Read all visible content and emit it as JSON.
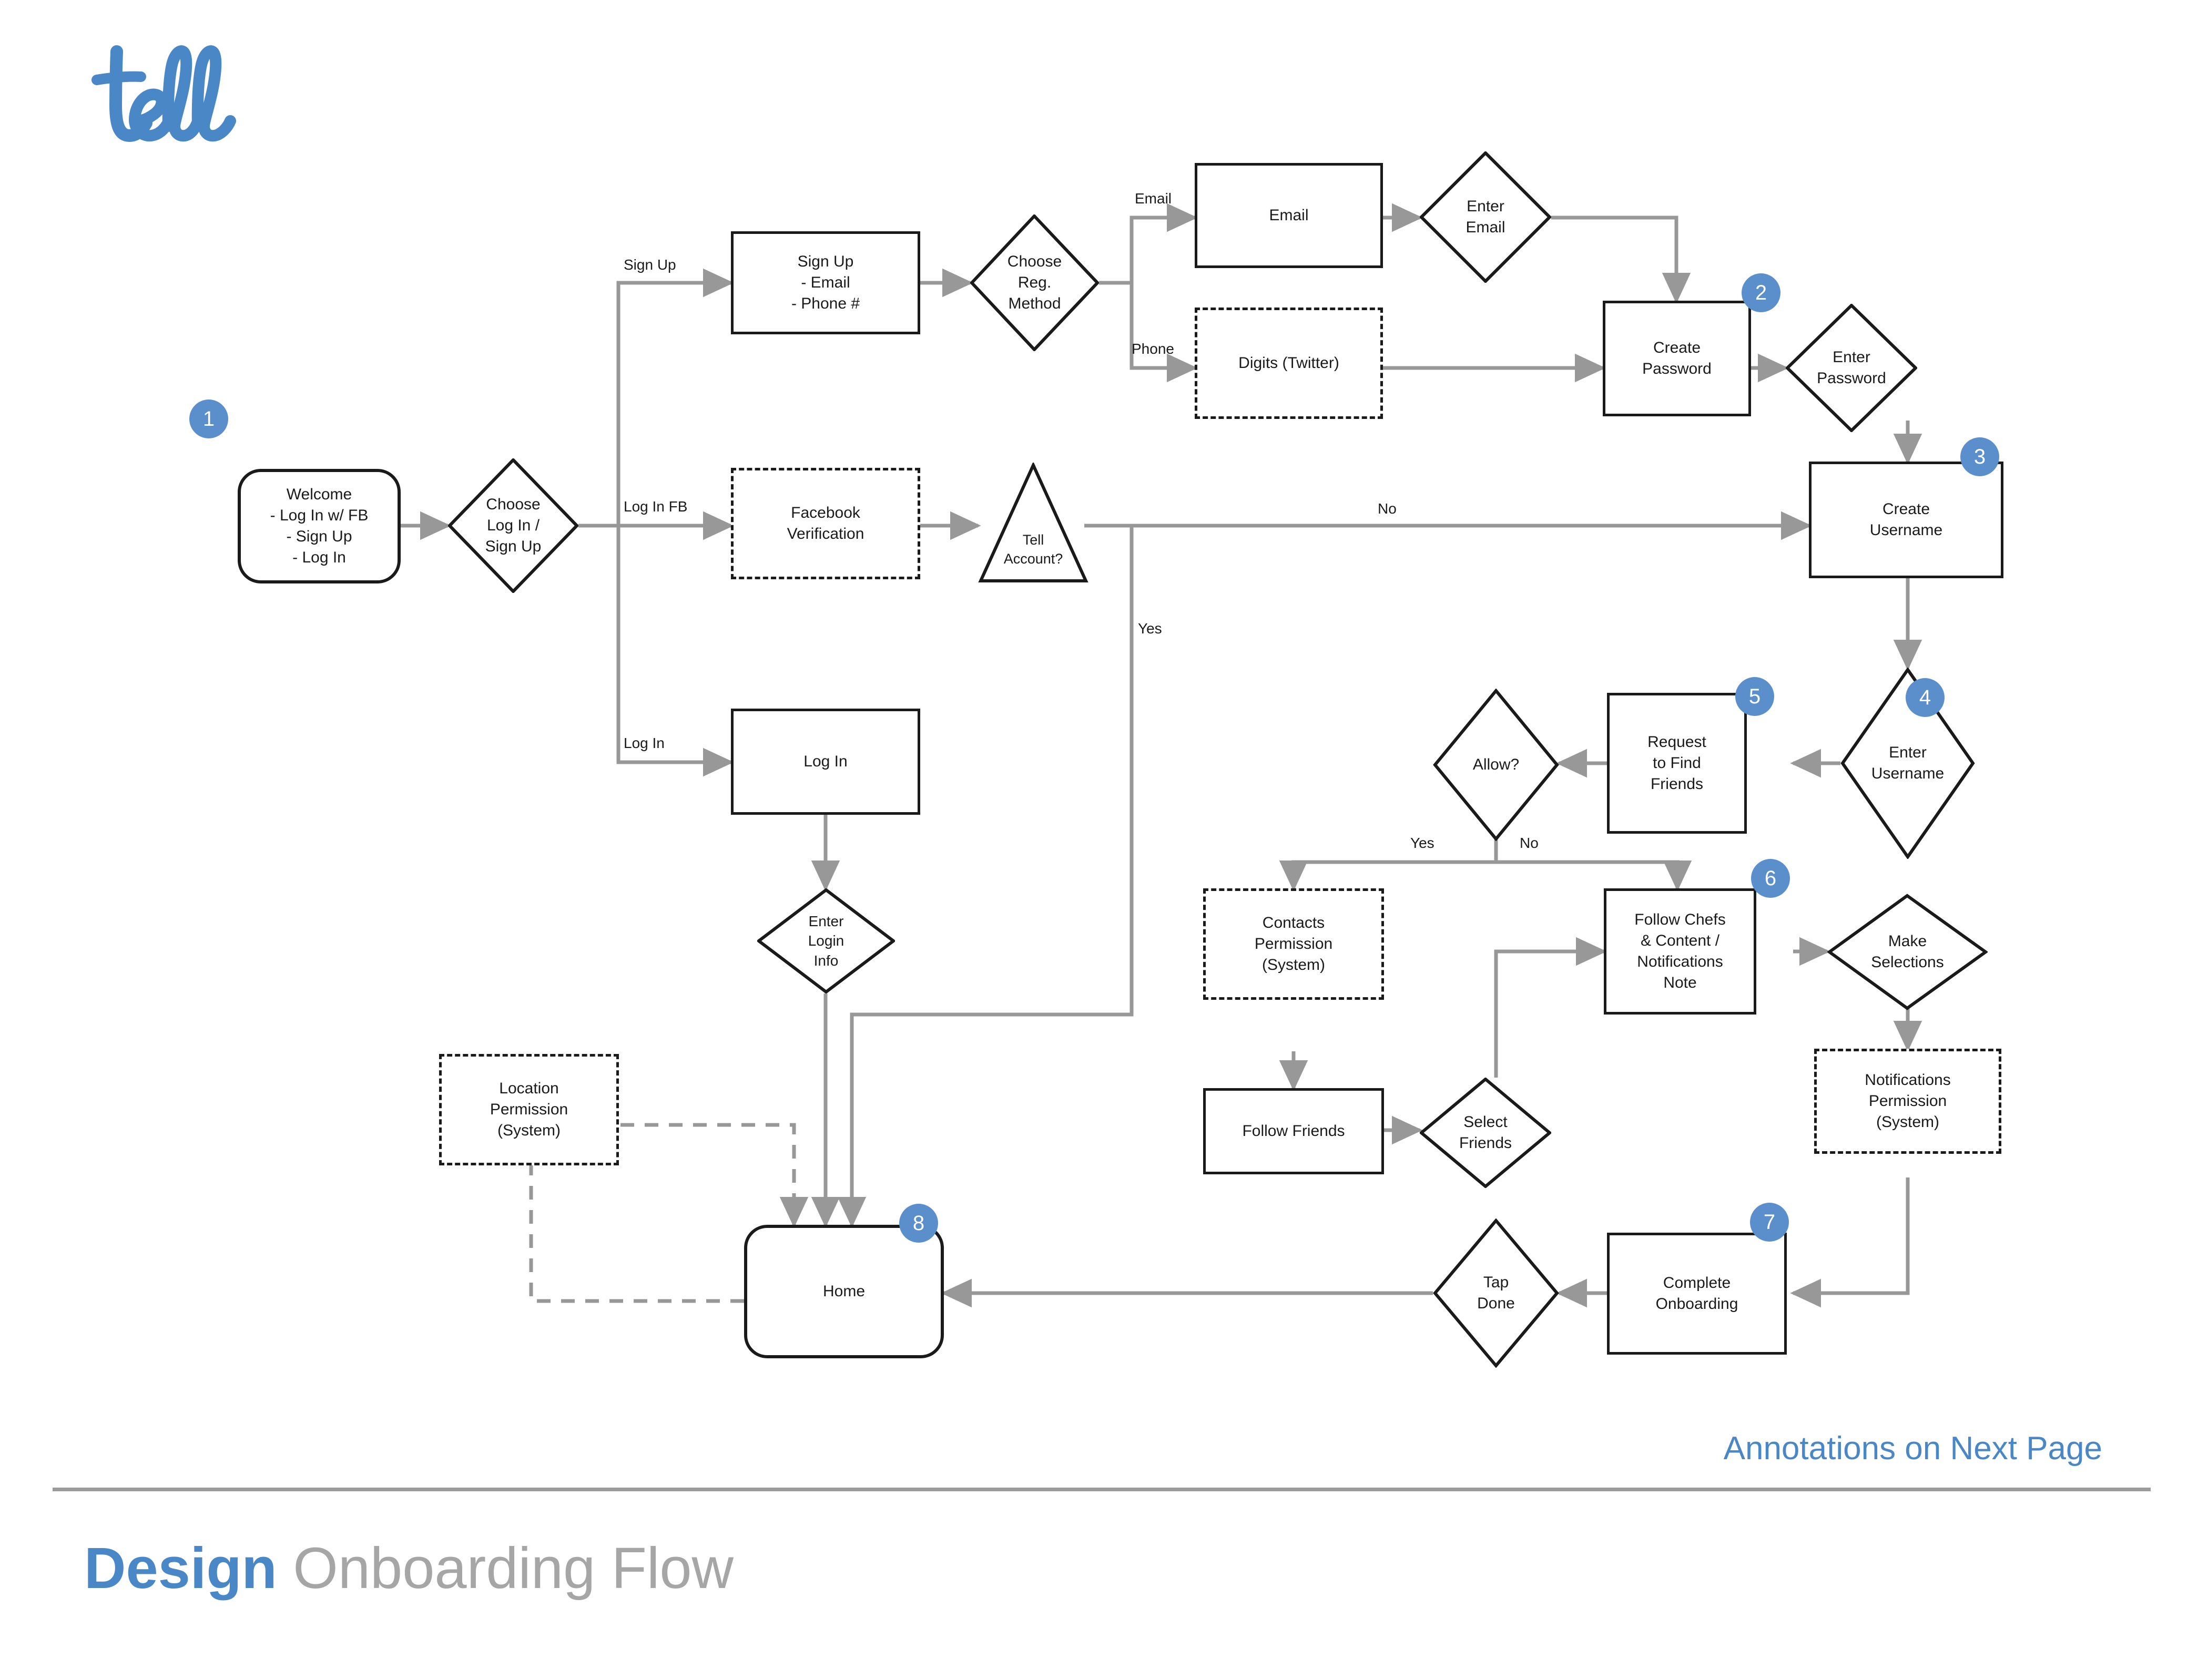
{
  "brand": {
    "logo_text": "tell",
    "logo_color": "#4a87c7"
  },
  "footer": {
    "annotations_note": "Annotations on Next Page",
    "title_strong": "Design",
    "title_light": " Onboarding Flow"
  },
  "colors": {
    "accent_blue": "#4a87c7",
    "badge_blue": "#5a8fcb",
    "edge_gray": "#989898",
    "node_black": "#1a1a1a",
    "title_gray": "#a6a6a6"
  },
  "nodes": {
    "welcome": "Welcome\n- Log In w/ FB\n- Sign Up\n- Log In",
    "choose_login_signup": "Choose\nLog In /\nSign Up",
    "signup": "Sign Up\n- Email\n- Phone #",
    "choose_reg_method": "Choose\nReg.\nMethod",
    "email": "Email",
    "enter_email": "Enter\nEmail",
    "digits_twitter": "Digits (Twitter)",
    "create_password": "Create\nPassword",
    "enter_password": "Enter\nPassword",
    "facebook_verification": "Facebook\nVerification",
    "tell_account": "Tell\nAccount?",
    "create_username": "Create\nUsername",
    "enter_username": "Enter\nUsername",
    "request_to_find_friends": "Request\nto Find\nFriends",
    "allow": "Allow?",
    "contacts_permission": "Contacts\nPermission\n(System)",
    "follow_friends": "Follow Friends",
    "select_friends": "Select\nFriends",
    "follow_chefs": "Follow Chefs\n& Content /\nNotifications\nNote",
    "make_selections": "Make\nSelections",
    "notifications_permission": "Notifications\nPermission\n(System)",
    "complete_onboarding": "Complete\nOnboarding",
    "tap_done": "Tap\nDone",
    "home": "Home",
    "log_in": "Log In",
    "enter_login_info": "Enter\nLogin\nInfo",
    "location_permission": "Location\nPermission\n(System)"
  },
  "edge_labels": {
    "sign_up": "Sign Up",
    "log_in_fb": "Log In FB",
    "log_in": "Log In",
    "email": "Email",
    "phone": "Phone",
    "no_tell_account": "No",
    "yes_tell_account": "Yes",
    "allow_yes": "Yes",
    "allow_no": "No"
  },
  "badges": {
    "b1": "1",
    "b2": "2",
    "b3": "3",
    "b4": "4",
    "b5": "5",
    "b6": "6",
    "b7": "7",
    "b8": "8"
  }
}
